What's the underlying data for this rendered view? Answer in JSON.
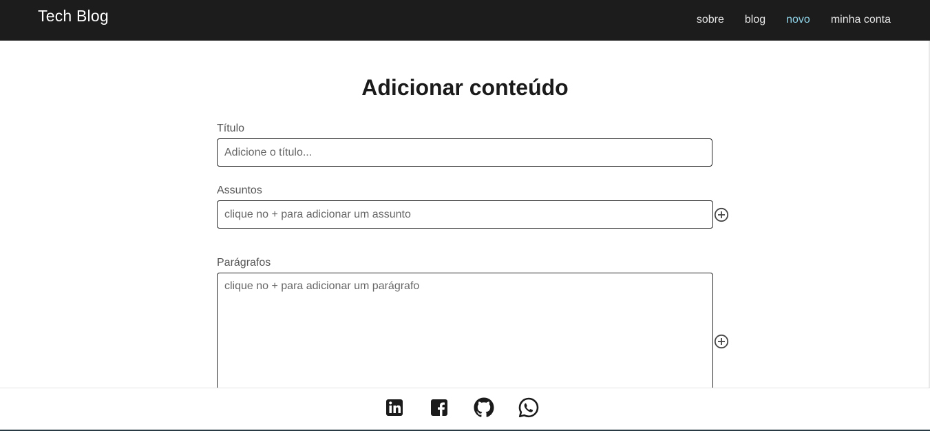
{
  "navbar": {
    "brand": "Tech Blog",
    "links": [
      {
        "label": "sobre",
        "active": false
      },
      {
        "label": "blog",
        "active": false
      },
      {
        "label": "novo",
        "active": true
      },
      {
        "label": "minha conta",
        "active": false
      }
    ]
  },
  "page": {
    "title": "Adicionar conteúdo"
  },
  "form": {
    "title_label": "Título",
    "title_placeholder": "Adicione o título...",
    "subjects_label": "Assuntos",
    "subjects_placeholder": "clique no + para adicionar um assunto",
    "paragraphs_label": "Parágrafos",
    "paragraphs_placeholder": "clique no + para adicionar um parágrafo"
  },
  "icons": {
    "add": "plus-circle-icon",
    "social": [
      "linkedin-icon",
      "facebook-icon",
      "github-icon",
      "whatsapp-icon"
    ]
  },
  "colors": {
    "navbar_bg": "#1c1c1c",
    "nav_active": "#8fd3e8",
    "text": "#1b1b1b"
  }
}
